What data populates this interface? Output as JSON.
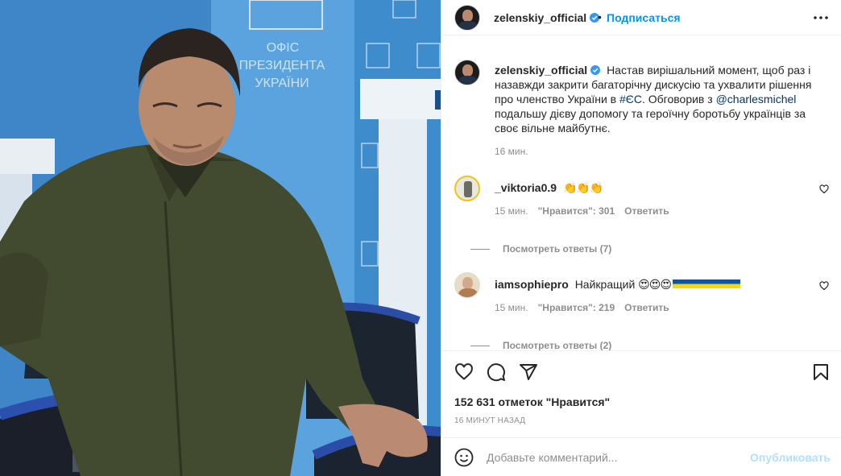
{
  "photo": {
    "alt_sign_lines": [
      "ОФІС",
      "ПРЕЗИДЕНТА",
      "УКРАЇНИ"
    ]
  },
  "header": {
    "username": "zelenskiy_official",
    "separator": "•",
    "follow_label": "Подписаться",
    "more_icon": "more-horizontal-icon"
  },
  "caption": {
    "username": "zelenskiy_official",
    "text_parts": {
      "before_tag": "Настав вирішальний момент, щоб раз і назавжди закрити багаторічну дискусію та ухвалити рішення про членство України в ",
      "hashtag": "#ЄС",
      "middle": ". Обговорив з ",
      "mention": "@charlesmichel",
      "after": " подальшу дієву допомогу та героїчну боротьбу українців за своє вільне майбутнє."
    },
    "time": "16 мин."
  },
  "comments": [
    {
      "username": "_viktoria0.9",
      "text": "👏👏👏",
      "time": "15 мин.",
      "likes": "\"Нравится\": 301",
      "reply_label": "Ответить",
      "view_replies": "Посмотреть ответы (7)"
    },
    {
      "username": "iamsophiepro",
      "text": "Найкращий",
      "emojis": "😍😍😍",
      "time": "15 мин.",
      "likes": "\"Нравится\": 219",
      "reply_label": "Ответить",
      "view_replies": "Посмотреть ответы (2)"
    }
  ],
  "actions": {
    "icons": [
      "heart-icon",
      "comment-icon",
      "share-icon",
      "bookmark-icon"
    ],
    "likes": "152 631 отметок \"Нравится\"",
    "time": "16 минут назад"
  },
  "add_comment": {
    "placeholder": "Добавьте комментарий...",
    "publish_label": "Опубликовать"
  },
  "colors": {
    "accent": "#0095f6",
    "link": "#00376b",
    "muted": "#8e8e8e",
    "publish_disabled": "#b2dffc",
    "verified": "#3897f0"
  }
}
